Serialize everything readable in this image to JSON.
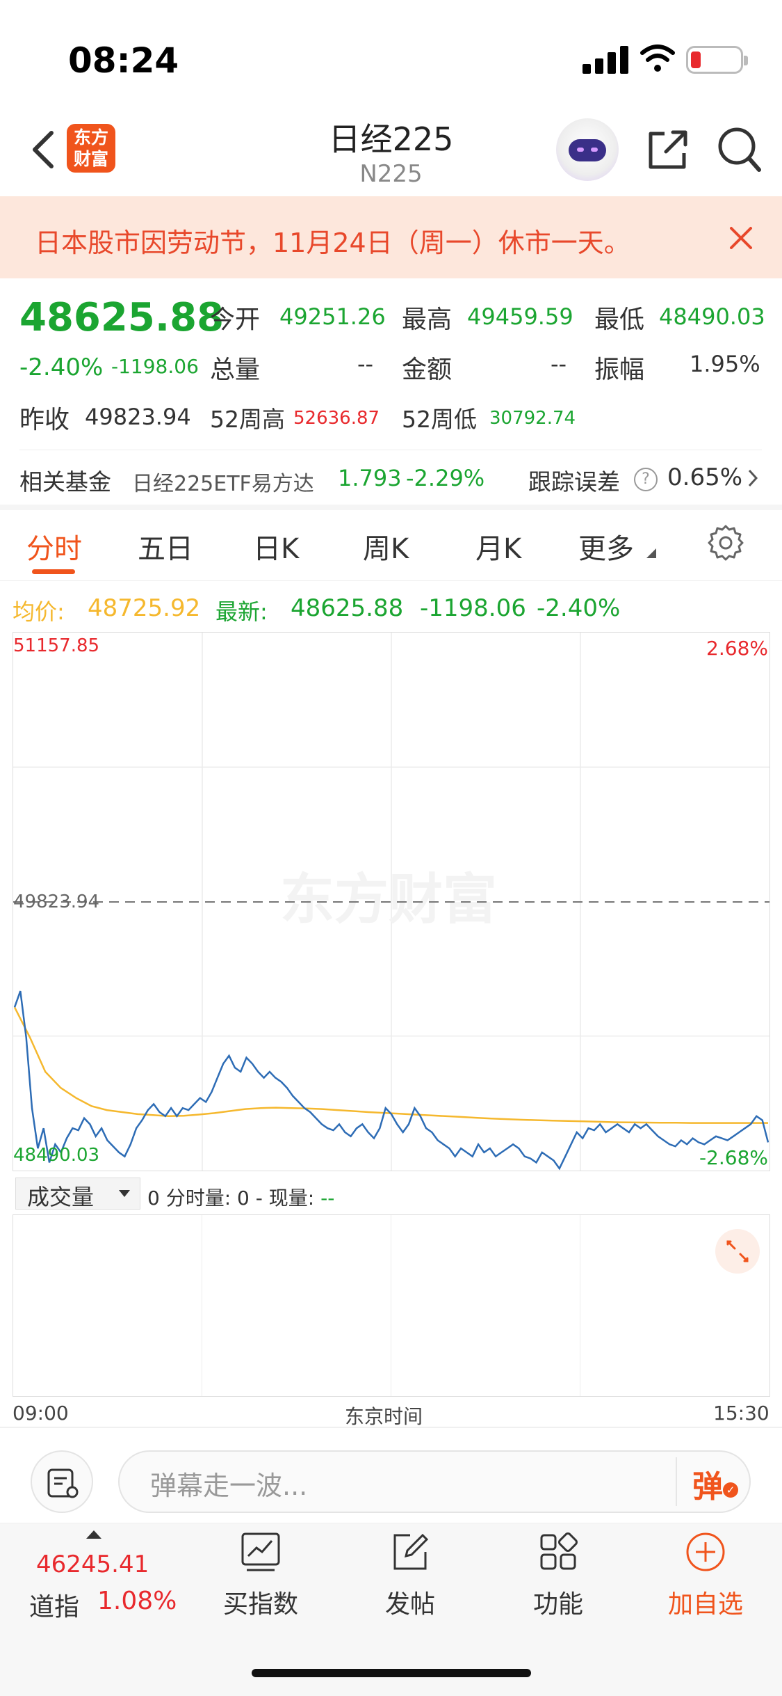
{
  "status": {
    "time": "08:24"
  },
  "header": {
    "title": "日经225",
    "subtitle": "N225",
    "logo_line1": "东方",
    "logo_line2": "财富"
  },
  "notice": {
    "text": "日本股市因劳动节，11月24日（周一）休市一天。"
  },
  "quote": {
    "price": "48625.88",
    "change_pct": "-2.40%",
    "change": "-1198.06",
    "open_label": "今开",
    "open": "49251.26",
    "high_label": "最高",
    "high": "49459.59",
    "low_label": "最低",
    "low": "48490.03",
    "volume_label": "总量",
    "volume": "--",
    "amount_label": "金额",
    "amount": "--",
    "amplitude_label": "振幅",
    "amplitude": "1.95%",
    "prev_close_label": "昨收",
    "prev_close": "49823.94",
    "wk52_high_label": "52周高",
    "wk52_high": "52636.87",
    "wk52_low_label": "52周低",
    "wk52_low": "30792.74"
  },
  "fund": {
    "label": "相关基金",
    "name": "日经225ETF易方达",
    "price": "1.793",
    "change": "-2.29%",
    "tracking_label": "跟踪误差",
    "tracking_value": "0.65%"
  },
  "tabs": [
    "分时",
    "五日",
    "日K",
    "周K",
    "月K",
    "更多"
  ],
  "info_line": {
    "avg_label": "均价:",
    "avg_value": "48725.92",
    "latest_label": "最新:",
    "latest_value": "48625.88",
    "latest_change": "-1198.06",
    "latest_pct": "-2.40%"
  },
  "chart_labels": {
    "top_left": "51157.85",
    "top_right": "2.68%",
    "mid": "49823.94",
    "bottom_left": "48490.03",
    "bottom_right": "-2.68%",
    "watermark": "东方财富"
  },
  "volume": {
    "select": "成交量",
    "summary_prefix": "0 分时量: 0 - 现量: ",
    "summary_value": "--"
  },
  "time_axis": {
    "start": "09:00",
    "mid": "东京时间",
    "end": "15:30"
  },
  "comment": {
    "placeholder": "弹幕走一波...",
    "danmu_button": "弹"
  },
  "bottom_nav": {
    "index_value": "46245.41",
    "index_name": "道指",
    "index_pct": "1.08%",
    "buy_index": "买指数",
    "post": "发帖",
    "functions": "功能",
    "add_watch": "加自选"
  },
  "colors": {
    "up": "#e8292d",
    "down": "#1ba531",
    "accent": "#f0541c",
    "price_line": "#2d6cb5",
    "avg_line": "#f5b82e"
  },
  "chart_data": {
    "type": "line",
    "y_range": [
      48490.03,
      51157.85
    ],
    "prev_close": 49823.94,
    "x_range": [
      "09:00",
      "15:30"
    ],
    "series": [
      {
        "name": "价格",
        "values": [
          49300,
          49380,
          49150,
          48800,
          48600,
          48700,
          48530,
          48620,
          48580,
          48650,
          48700,
          48690,
          48750,
          48720,
          48660,
          48700,
          48640,
          48610,
          48580,
          48560,
          48620,
          48700,
          48740,
          48790,
          48820,
          48780,
          48760,
          48800,
          48760,
          48800,
          48790,
          48820,
          48850,
          48830,
          48880,
          48950,
          49020,
          49060,
          49000,
          48980,
          49050,
          49020,
          48980,
          48950,
          48980,
          48950,
          48930,
          48900,
          48860,
          48830,
          48800,
          48780,
          48750,
          48720,
          48700,
          48690,
          48720,
          48680,
          48660,
          48700,
          48720,
          48680,
          48650,
          48700,
          48800,
          48770,
          48720,
          48680,
          48720,
          48800,
          48760,
          48700,
          48680,
          48640,
          48620,
          48600,
          48560,
          48600,
          48580,
          48560,
          48620,
          48580,
          48600,
          48560,
          48580,
          48600,
          48620,
          48600,
          48560,
          48550,
          48530,
          48580,
          48560,
          48540,
          48500,
          48560,
          48620,
          48680,
          48650,
          48700,
          48690,
          48720,
          48680,
          48700,
          48720,
          48700,
          48680,
          48720,
          48700,
          48720,
          48690,
          48660,
          48640,
          48620,
          48610,
          48640,
          48620,
          48650,
          48630,
          48620,
          48640,
          48660,
          48650,
          48640,
          48660,
          48680,
          48700,
          48720,
          48760,
          48740,
          48630
        ]
      },
      {
        "name": "均价",
        "values": [
          49300,
          49150,
          48980,
          48900,
          48850,
          48810,
          48790,
          48780,
          48770,
          48765,
          48760,
          48762,
          48768,
          48775,
          48785,
          48795,
          48800,
          48802,
          48800,
          48798,
          48795,
          48790,
          48785,
          48780,
          48776,
          48772,
          48768,
          48764,
          48760,
          48756,
          48752,
          48748,
          48745,
          48742,
          48740,
          48738,
          48736,
          48734,
          48732,
          48730,
          48729,
          48728,
          48727,
          48727,
          48726,
          48726,
          48726,
          48726,
          48726,
          48726
        ]
      }
    ]
  }
}
